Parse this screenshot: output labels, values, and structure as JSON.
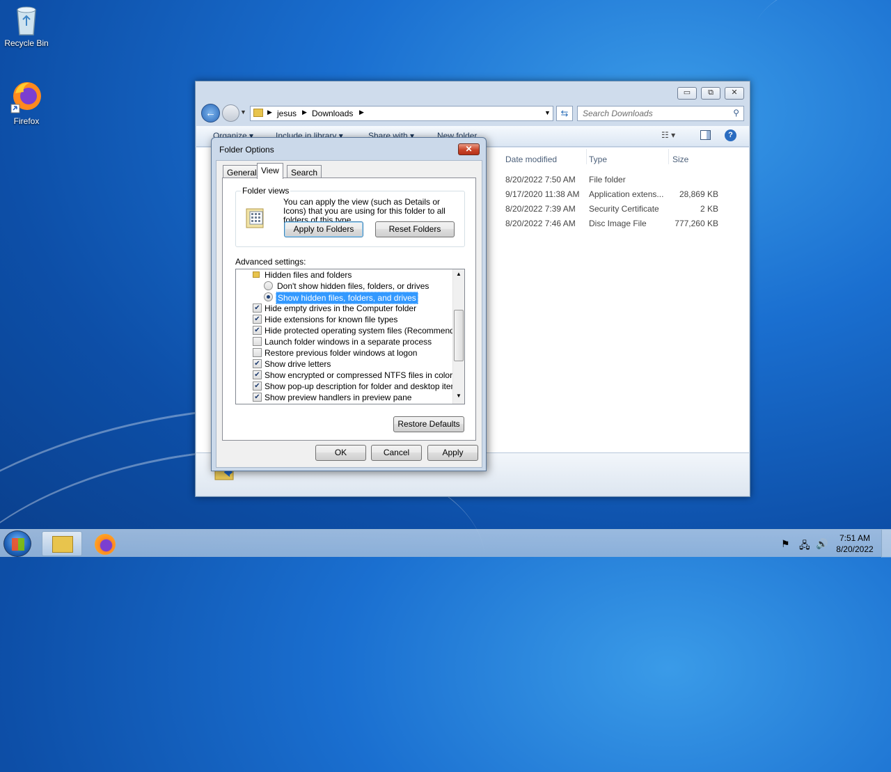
{
  "desktop": {
    "icons": [
      {
        "label": "Recycle Bin"
      },
      {
        "label": "Firefox"
      }
    ]
  },
  "explorer": {
    "address": {
      "crumb1": "jesus",
      "crumb2": "Downloads"
    },
    "search_placeholder": "Search Downloads",
    "toolbar": {
      "organize": "Organize ▾",
      "include": "Include in library ▾",
      "share": "Share with ▾",
      "new_folder": "New folder"
    },
    "columns": {
      "date": "Date modified",
      "type": "Type",
      "size": "Size"
    },
    "rows": [
      {
        "date": "8/20/2022 7:50 AM",
        "type": "File folder",
        "size": ""
      },
      {
        "date": "9/17/2020 11:38 AM",
        "type": "Application extens...",
        "size": "28,869 KB"
      },
      {
        "date": "8/20/2022 7:39 AM",
        "type": "Security Certificate",
        "size": "2 KB"
      },
      {
        "date": "8/20/2022 7:46 AM",
        "type": "Disc Image File",
        "size": "777,260 KB"
      }
    ]
  },
  "dialog": {
    "title": "Folder Options",
    "tabs": [
      "General",
      "View",
      "Search"
    ],
    "folder_views": {
      "legend": "Folder views",
      "description": "You can apply the view (such as Details or Icons) that you are using for this folder to all folders of this type.",
      "apply_btn": "Apply to Folders",
      "reset_btn": "Reset Folders"
    },
    "advanced_label": "Advanced settings:",
    "settings": {
      "hidden_group": "Hidden files and folders",
      "dont_show": "Don't show hidden files, folders, or drives",
      "show_hidden": "Show hidden files, folders, and drives",
      "hide_empty": "Hide empty drives in the Computer folder",
      "hide_ext": "Hide extensions for known file types",
      "hide_protected": "Hide protected operating system files (Recommended)",
      "launch_separate": "Launch folder windows in a separate process",
      "restore_prev": "Restore previous folder windows at logon",
      "show_drive": "Show drive letters",
      "show_encrypted": "Show encrypted or compressed NTFS files in color",
      "show_popup": "Show pop-up description for folder and desktop items",
      "show_preview": "Show preview handlers in preview pane"
    },
    "restore_defaults": "Restore Defaults",
    "ok": "OK",
    "cancel": "Cancel",
    "apply": "Apply"
  },
  "taskbar": {
    "time": "7:51 AM",
    "date": "8/20/2022"
  }
}
